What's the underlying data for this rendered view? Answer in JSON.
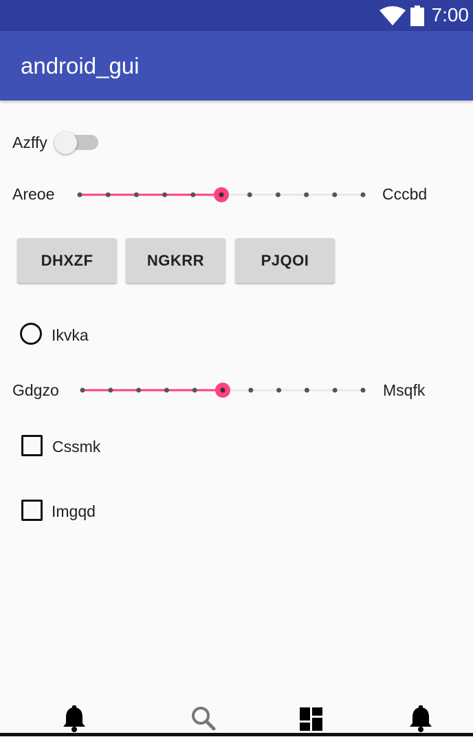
{
  "status_bar": {
    "time": "7:00",
    "wifi_icon": "wifi-icon",
    "battery_icon": "battery-icon"
  },
  "app_bar": {
    "title": "android_gui"
  },
  "switch_row": {
    "label": "Azffy",
    "on": false
  },
  "slider1": {
    "min_label": "Areoe",
    "max_label": "Cccbd",
    "steps": 10,
    "value": 5
  },
  "buttons": [
    "DHXZF",
    "NGKRR",
    "PJQOI"
  ],
  "radio": {
    "label": "Ikvka",
    "checked": false
  },
  "slider2": {
    "min_label": "Gdgzo",
    "max_label": "Msqfk",
    "steps": 10,
    "value": 5
  },
  "checkbox1": {
    "label": "Cssmk",
    "checked": false
  },
  "checkbox2": {
    "label": "Imgqd",
    "checked": false
  },
  "bottom_nav": [
    "notifications-icon",
    "search-icon",
    "dashboard-icon",
    "notifications-icon"
  ],
  "colors": {
    "primary": "#3f51b5",
    "primary_dark": "#303f9f",
    "accent": "#ff4081"
  }
}
